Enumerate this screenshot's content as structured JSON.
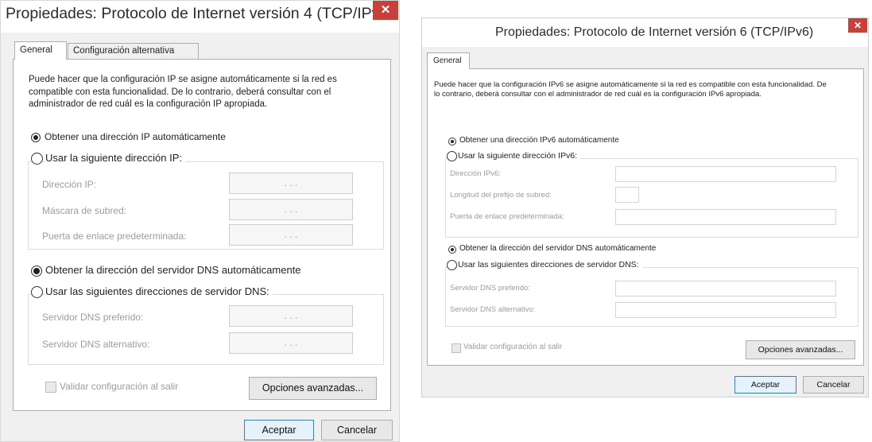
{
  "ipv4": {
    "title": "Propiedades: Protocolo de Internet versión 4 (TCP/IPv...",
    "close": "✕",
    "tabs": [
      "General",
      "Configuración alternativa"
    ],
    "description": "Puede hacer que la configuración IP se asigne automáticamente si la red es compatible con esta funcionalidad. De lo contrario, deberá consultar con el administrador de red cuál es la configuración IP apropiada.",
    "radio_ip_auto": "Obtener una dirección IP automáticamente",
    "radio_ip_manual": "Usar la siguiente dirección IP:",
    "ip_address_label": "Dirección IP:",
    "subnet_label": "Máscara de subred:",
    "gateway_label": "Puerta de enlace predeterminada:",
    "ip_placeholder": ". . .",
    "radio_dns_auto": "Obtener la dirección del servidor DNS automáticamente",
    "radio_dns_manual": "Usar las siguientes direcciones de servidor DNS:",
    "dns_pref_label": "Servidor DNS preferido:",
    "dns_alt_label": "Servidor DNS alternativo:",
    "validate_label": "Validar configuración al salir",
    "advanced_button": "Opciones avanzadas...",
    "ok_button": "Aceptar",
    "cancel_button": "Cancelar"
  },
  "ipv6": {
    "title": "Propiedades: Protocolo de Internet versión 6 (TCP/IPv6)",
    "close": "✕",
    "tabs": [
      "General"
    ],
    "description": "Puede hacer que la configuración IPv6 se asigne automáticamente si la red es compatible con esta funcionalidad. De lo contrario, deberá consultar con el administrador de red cuál es la configuración IPv6 apropiada.",
    "radio_ip_auto": "Obtener una dirección IPv6 automáticamente",
    "radio_ip_manual": "Usar la siguiente dirección IPv6:",
    "ip_address_label": "Dirección IPv6:",
    "prefix_label": "Longitud del prefijo de subred:",
    "gateway_label": "Puerta de enlace predeterminada:",
    "radio_dns_auto": "Obtener la dirección del servidor DNS automáticamente",
    "radio_dns_manual": "Usar las siguientes direcciones de servidor DNS:",
    "dns_pref_label": "Servidor DNS preferido:",
    "dns_alt_label": "Servidor DNS alternativo:",
    "validate_label": "Validar configuración al salir",
    "advanced_button": "Opciones avanzadas...",
    "ok_button": "Aceptar",
    "cancel_button": "Cancelar"
  },
  "colors": {
    "close_red": "#c7403a",
    "default_button_border": "#3c7fb1",
    "window_bg": "#f0f0f0"
  }
}
